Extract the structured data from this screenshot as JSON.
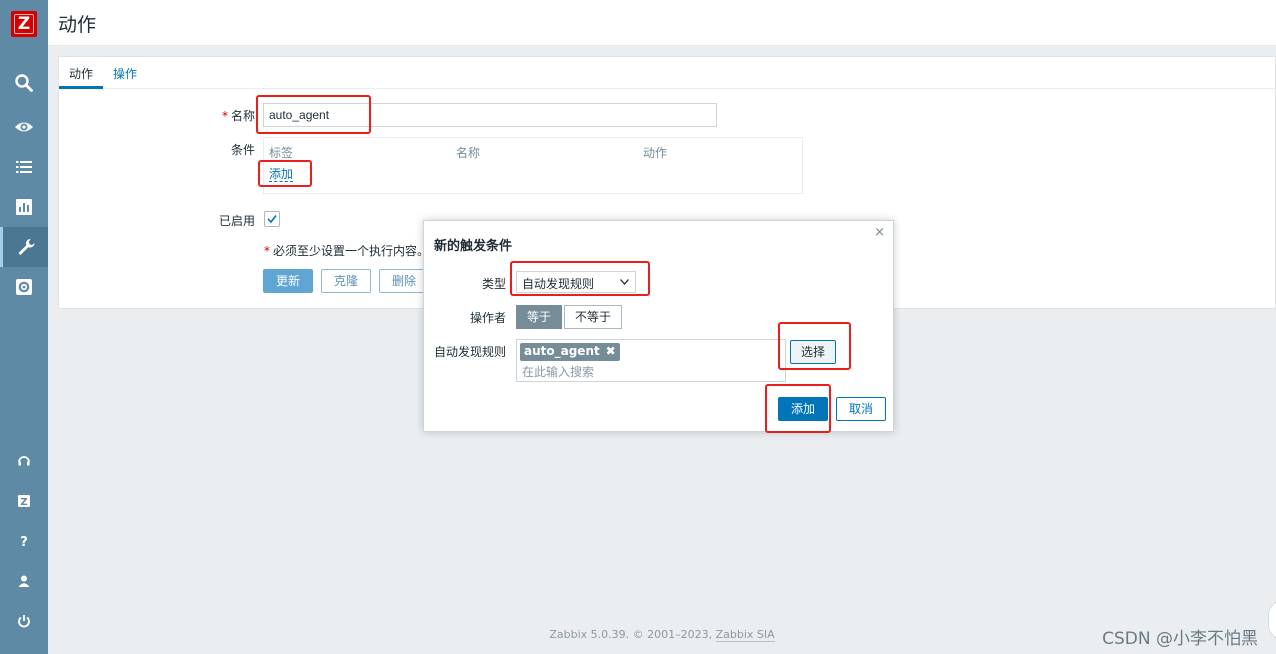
{
  "app": {
    "logo_letter": "Z",
    "page_title": "动作"
  },
  "sidebar": {
    "items": [
      {
        "icon": "search-icon"
      },
      {
        "icon": "eye-icon"
      },
      {
        "icon": "list-icon"
      },
      {
        "icon": "chart-icon"
      },
      {
        "icon": "wrench-icon",
        "active": true
      },
      {
        "icon": "gear-icon"
      }
    ],
    "bottom_items": [
      {
        "icon": "headset-icon"
      },
      {
        "icon": "zabbix-share-icon",
        "glyph": "Z"
      },
      {
        "icon": "help-icon",
        "glyph": "?"
      },
      {
        "icon": "user-icon"
      },
      {
        "icon": "power-icon"
      }
    ]
  },
  "tabs": [
    {
      "label": "动作"
    },
    {
      "label": "操作"
    }
  ],
  "form": {
    "name_label": "名称",
    "name_value": "auto_agent",
    "conditions_label": "条件",
    "conditions_headers": [
      "标签",
      "名称",
      "动作"
    ],
    "add_link": "添加",
    "enabled_label": "已启用",
    "enabled_checked": true,
    "note": "必须至少设置一个执行内容。",
    "buttons": {
      "update": "更新",
      "clone": "克隆",
      "delete": "删除"
    }
  },
  "dialog": {
    "title": "新的触发条件",
    "close": "×",
    "type_label": "类型",
    "type_value": "自动发现规则",
    "operator_label": "操作者",
    "operator_options": [
      "等于",
      "不等于"
    ],
    "operator_selected": "等于",
    "rule_label": "自动发现规则",
    "rule_chip": "auto_agent",
    "rule_chip_remove": "✖",
    "rule_placeholder": "在此输入搜索",
    "select_button": "选择",
    "add_button": "添加",
    "cancel_button": "取消"
  },
  "footer": {
    "text": "Zabbix 5.0.39. © 2001–2023,",
    "link": "Zabbix SIA"
  },
  "watermark": "CSDN @小李不怕黑",
  "colors": {
    "sidebar": "#5e8aa6",
    "primary": "#0275b8",
    "annotation": "#e8201c"
  }
}
